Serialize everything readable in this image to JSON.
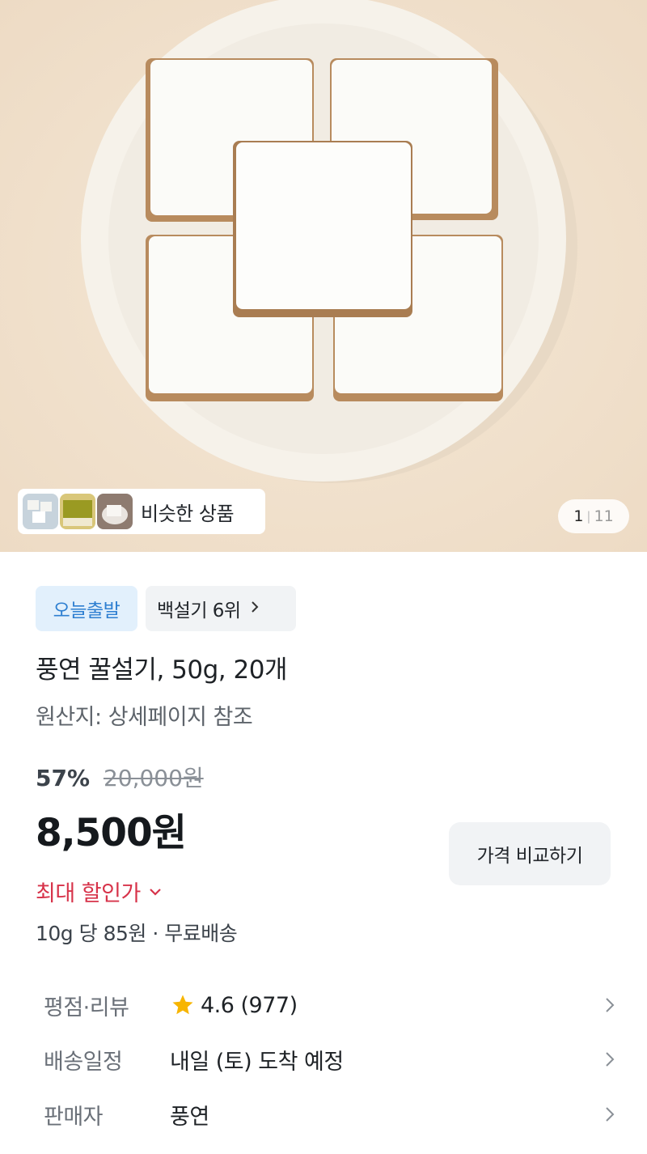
{
  "gallery": {
    "similar_label": "비슷한 상품",
    "counter_current": "1",
    "counter_total": "11",
    "counter_separator": "|"
  },
  "badges": {
    "today_ship": "오늘출발",
    "rank": "백설기 6위"
  },
  "product": {
    "title": "풍연 꿀설기, 50g, 20개",
    "origin": "원산지: 상세페이지 참조"
  },
  "pricing": {
    "discount_pct": "57%",
    "original_price": "20,000원",
    "price": "8,500원",
    "compare_label": "가격 비교하기",
    "max_discount_label": "최대 할인가",
    "unit_price": "10g 당 85원 · 무료배송"
  },
  "details": {
    "rating_label": "평점·리뷰",
    "rating_value": "4.6 (977)",
    "delivery_label": "배송일정",
    "delivery_value": "내일 (토) 도착 예정",
    "seller_label": "판매자",
    "seller_value": "풍연"
  },
  "colors": {
    "accent_blue": "#2e7fd1",
    "discount_red": "#d7334a",
    "star": "#f7b500"
  },
  "icons": [
    "star-icon",
    "chevron-right-icon",
    "chevron-down-icon"
  ]
}
